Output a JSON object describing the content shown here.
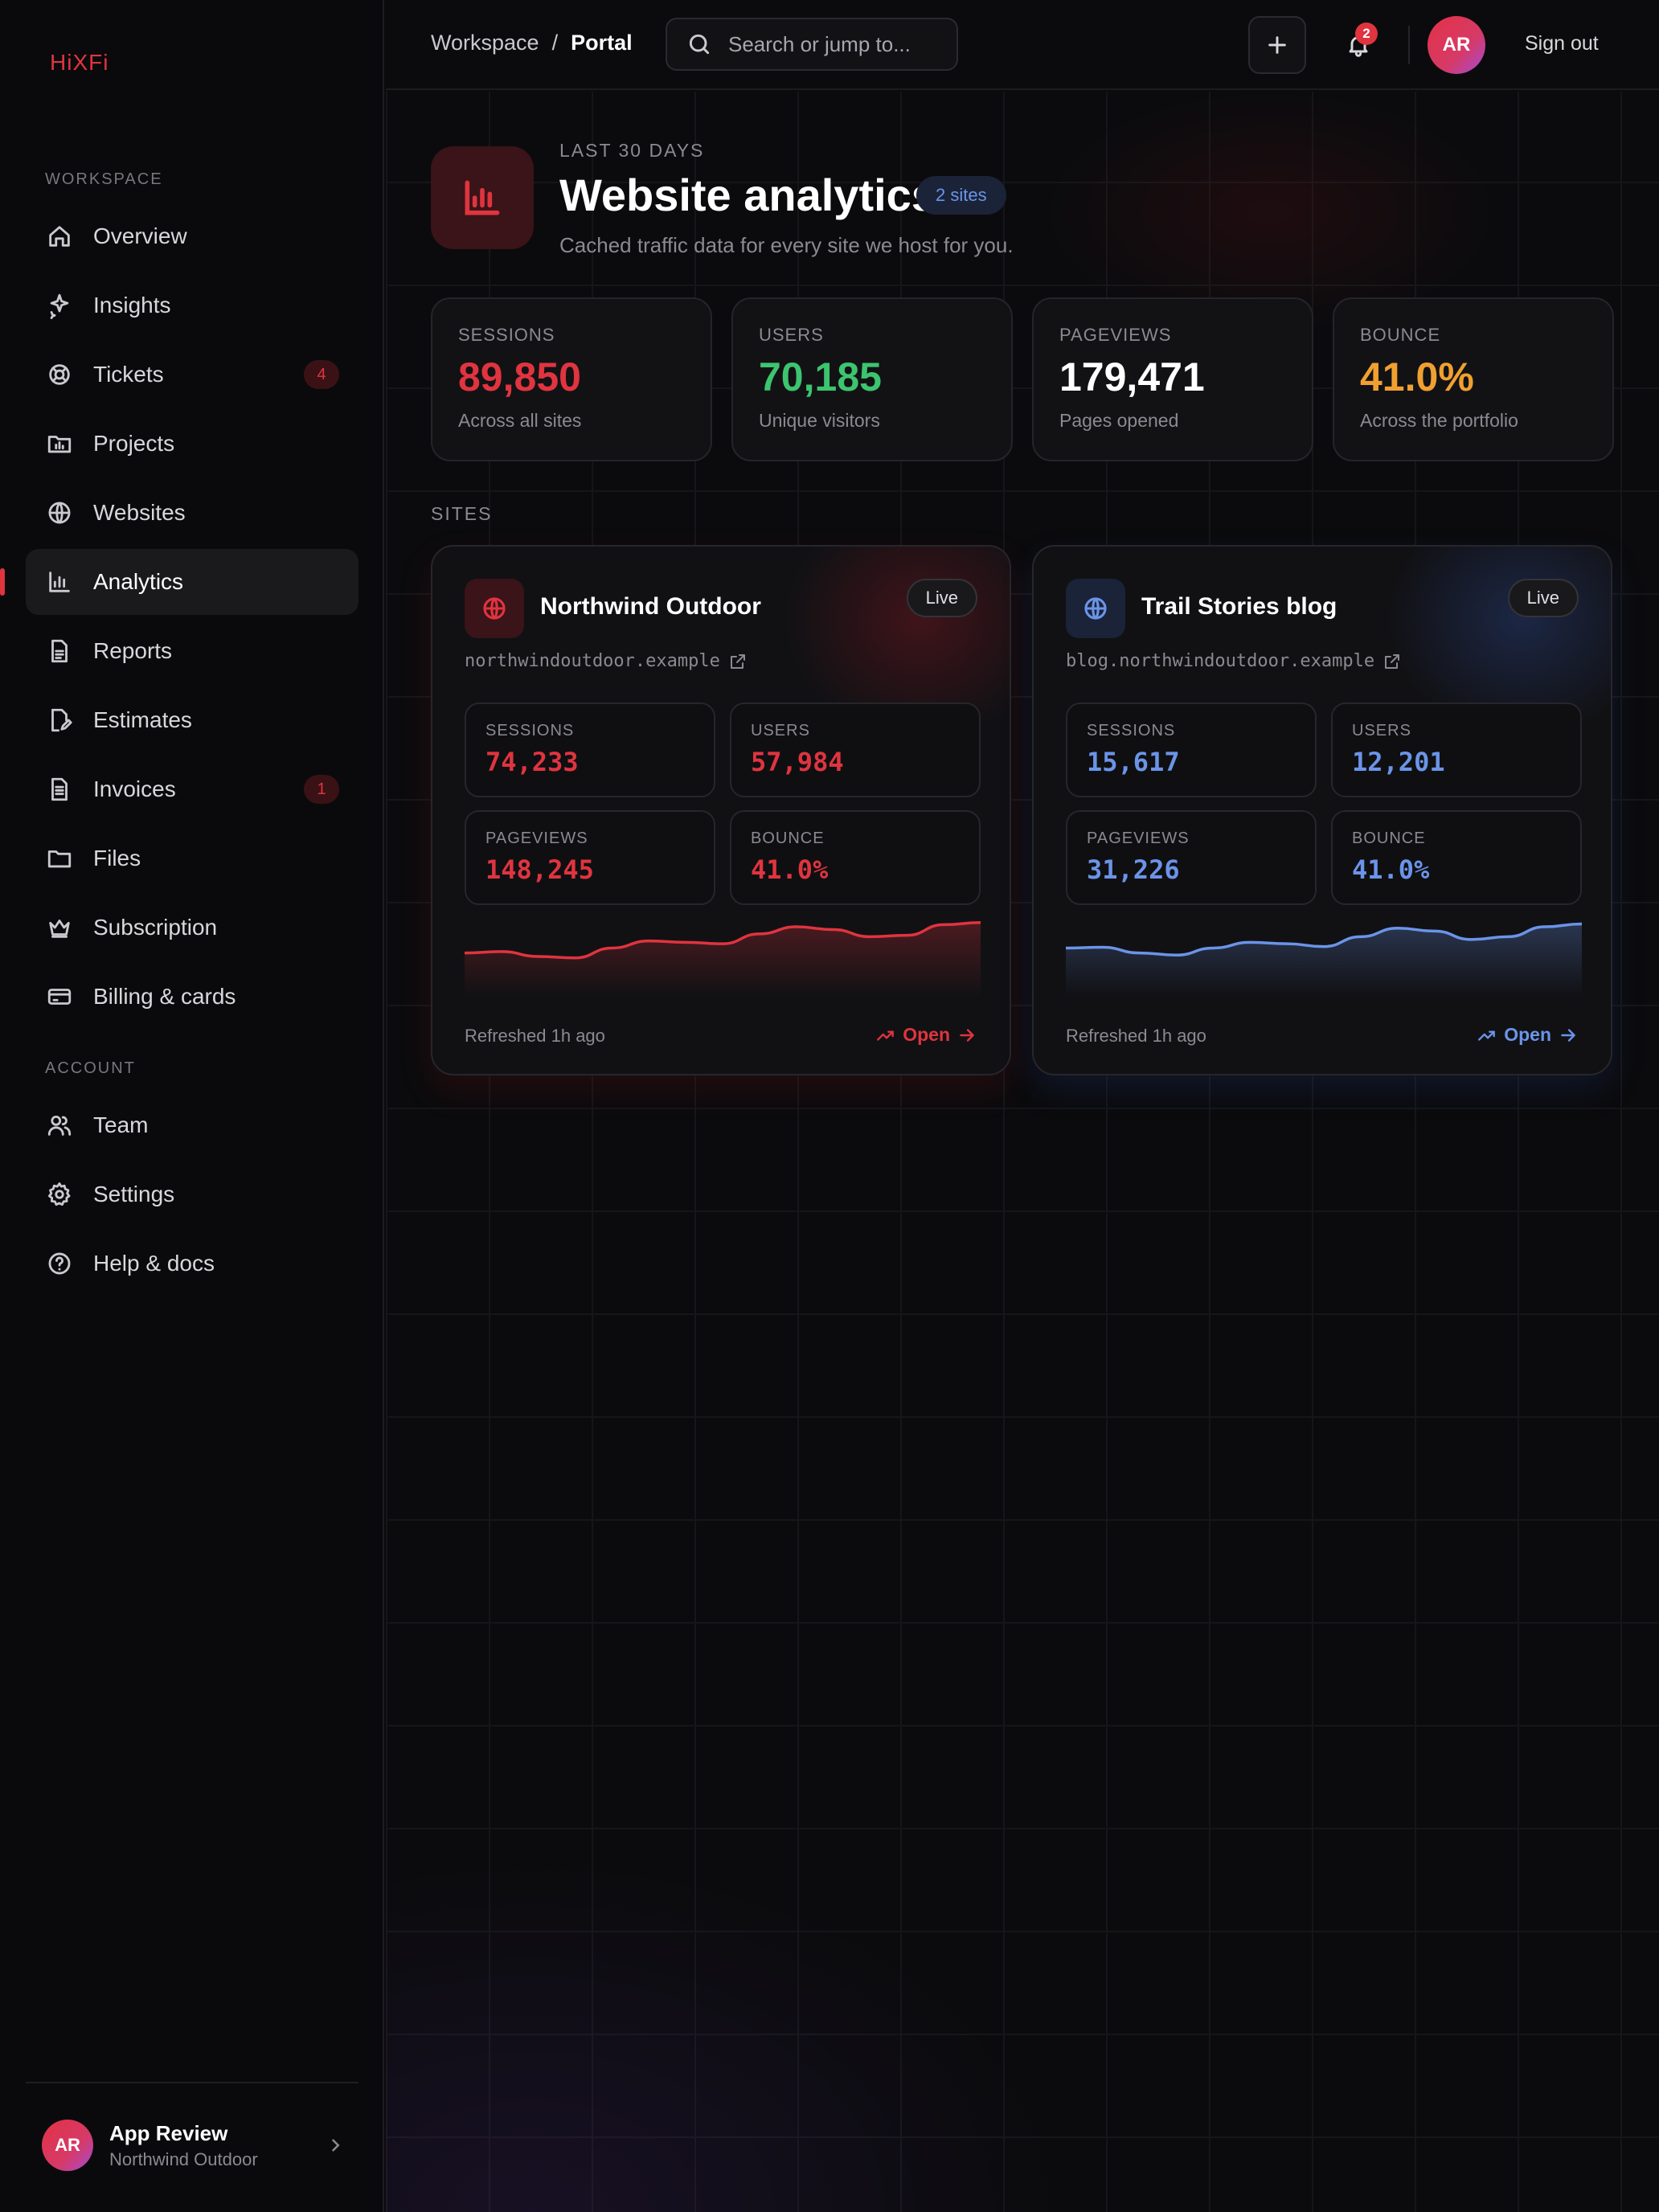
{
  "brand": "HiXFi",
  "sidebar": {
    "workspace_label": "WORKSPACE",
    "account_label": "ACCOUNT",
    "workspace_items": [
      {
        "label": "Overview",
        "icon": "home-icon"
      },
      {
        "label": "Insights",
        "icon": "sparkle-icon"
      },
      {
        "label": "Tickets",
        "icon": "lifebuoy-icon",
        "badge": "4"
      },
      {
        "label": "Projects",
        "icon": "folder-chart-icon"
      },
      {
        "label": "Websites",
        "icon": "globe-icon"
      },
      {
        "label": "Analytics",
        "icon": "bar-chart-icon",
        "active": true
      },
      {
        "label": "Reports",
        "icon": "document-icon"
      },
      {
        "label": "Estimates",
        "icon": "document-edit-icon"
      },
      {
        "label": "Invoices",
        "icon": "invoice-icon",
        "badge": "1"
      },
      {
        "label": "Files",
        "icon": "folder-icon"
      },
      {
        "label": "Subscription",
        "icon": "crown-icon"
      },
      {
        "label": "Billing & cards",
        "icon": "credit-card-icon"
      }
    ],
    "account_items": [
      {
        "label": "Team",
        "icon": "users-icon"
      },
      {
        "label": "Settings",
        "icon": "gear-icon"
      },
      {
        "label": "Help & docs",
        "icon": "help-circle-icon"
      }
    ],
    "user": {
      "initials": "AR",
      "name": "App Review",
      "org": "Northwind Outdoor"
    }
  },
  "topbar": {
    "crumb_root": "Workspace",
    "crumb_sep": "/",
    "crumb_current": "Portal",
    "search_placeholder": "Search or jump to...",
    "notif_count": "2",
    "avatar_initials": "AR",
    "sign_out": "Sign out"
  },
  "header": {
    "eyebrow": "LAST 30 DAYS",
    "title": "Website analytics",
    "pill": "2 sites",
    "subtitle": "Cached traffic data for every site we host for you."
  },
  "stats": [
    {
      "label": "SESSIONS",
      "value": "89,850",
      "sub": "Across all sites",
      "color": "#e0343f"
    },
    {
      "label": "USERS",
      "value": "70,185",
      "sub": "Unique visitors",
      "color": "#3dc46f"
    },
    {
      "label": "PAGEVIEWS",
      "value": "179,471",
      "sub": "Pages opened",
      "color": "#ffffff"
    },
    {
      "label": "BOUNCE",
      "value": "41.0%",
      "sub": "Across the portfolio",
      "color": "#f0a030"
    }
  ],
  "sites_label": "SITES",
  "sites": [
    {
      "name": "Northwind Outdoor",
      "status": "Live",
      "url": "northwindoutdoor.example",
      "accent": "#e0343f",
      "metrics": [
        {
          "label": "SESSIONS",
          "value": "74,233"
        },
        {
          "label": "USERS",
          "value": "57,984"
        },
        {
          "label": "PAGEVIEWS",
          "value": "148,245"
        },
        {
          "label": "BOUNCE",
          "value": "41.0%"
        }
      ],
      "trend": [
        0.55,
        0.57,
        0.5,
        0.48,
        0.62,
        0.72,
        0.7,
        0.68,
        0.82,
        0.92,
        0.88,
        0.78,
        0.8,
        0.95,
        0.98
      ],
      "refreshed": "Refreshed 1h ago",
      "open": "Open"
    },
    {
      "name": "Trail Stories blog",
      "status": "Live",
      "url": "blog.northwindoutdoor.example",
      "accent": "#6b94e8",
      "metrics": [
        {
          "label": "SESSIONS",
          "value": "15,617"
        },
        {
          "label": "USERS",
          "value": "12,201"
        },
        {
          "label": "PAGEVIEWS",
          "value": "31,226"
        },
        {
          "label": "BOUNCE",
          "value": "41.0%"
        }
      ],
      "trend": [
        0.62,
        0.63,
        0.55,
        0.52,
        0.62,
        0.7,
        0.68,
        0.64,
        0.78,
        0.9,
        0.86,
        0.74,
        0.78,
        0.92,
        0.96
      ],
      "refreshed": "Refreshed 1h ago",
      "open": "Open"
    }
  ]
}
